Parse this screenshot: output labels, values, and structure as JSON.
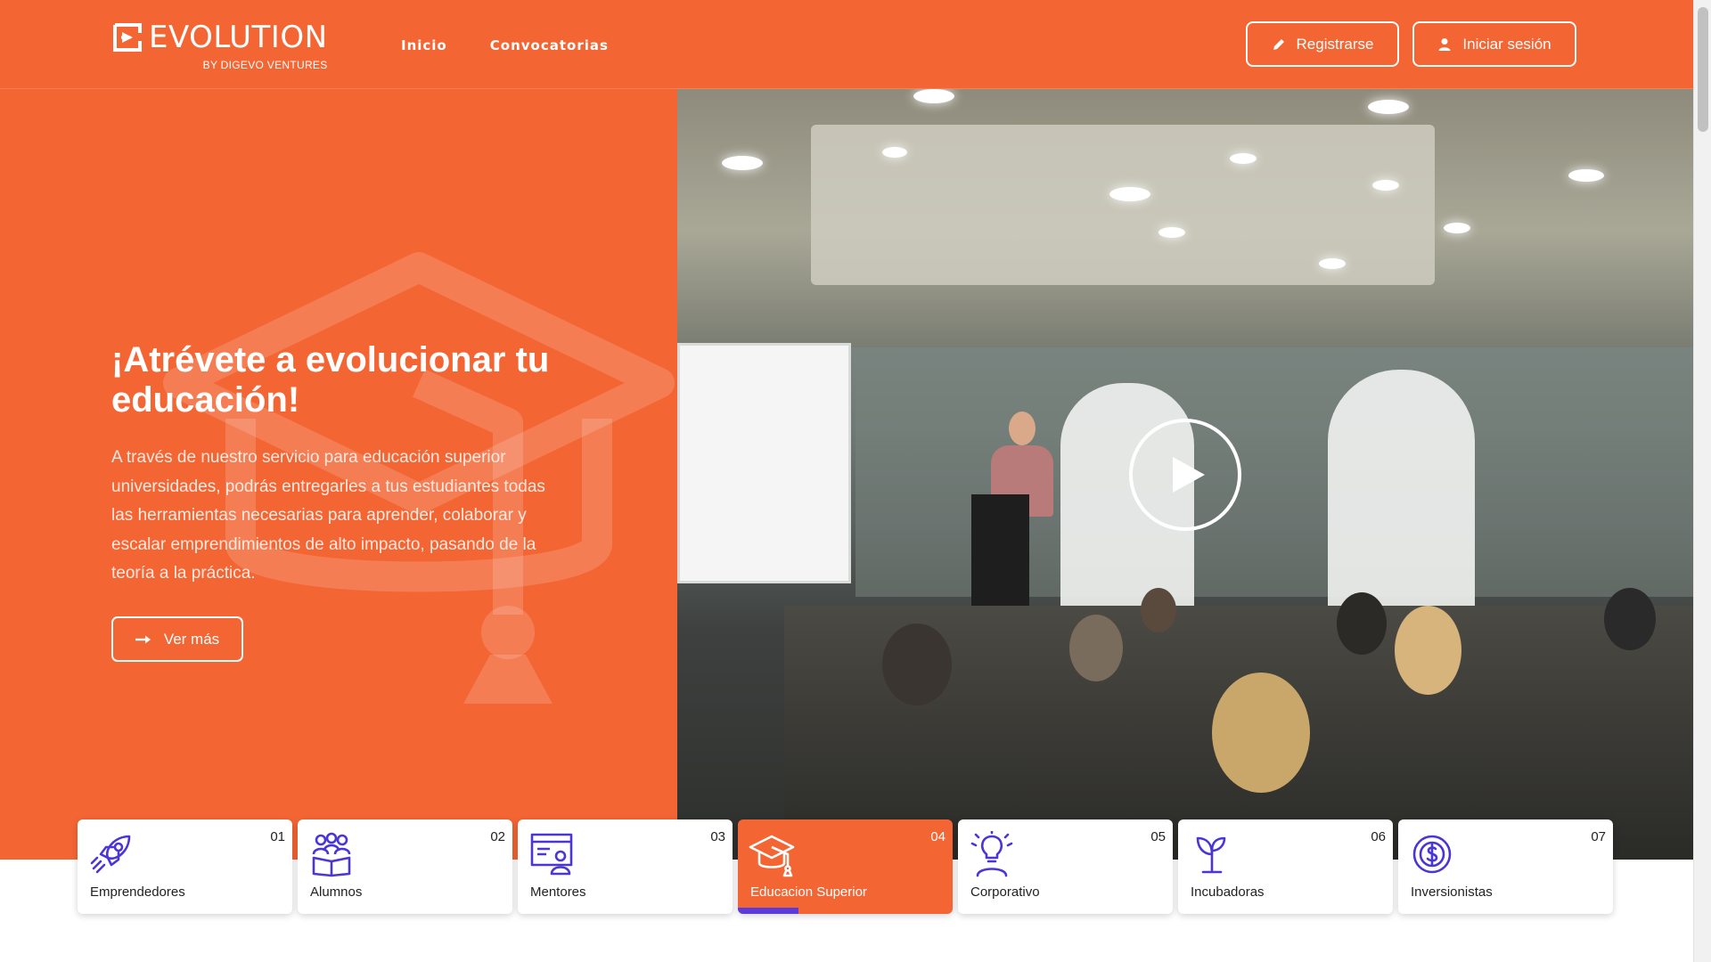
{
  "brand": {
    "name": "EVOLUTION",
    "sub": "BY DIGEVO VENTURES"
  },
  "nav": {
    "items": [
      "Inicio",
      "Convocatorias"
    ]
  },
  "header": {
    "register_label": "Registrarse",
    "login_label": "Iniciar sesión",
    "register_icon": "pencil-icon",
    "login_icon": "user-icon"
  },
  "hero": {
    "title": "¡Atrévete a evolucionar tu educación!",
    "description": "A través de nuestro servicio para educación superior universidades, podrás entregarles a tus estudiantes todas las herramientas necesarias para aprender, colaborar y escalar emprendimientos de alto impacto, pasando de la teoría a la práctica.",
    "cta_label": "Ver más",
    "cta_icon": "arrow-right-icon",
    "background_icon": "graduation-cap-icon",
    "video_icon": "play-icon"
  },
  "categories": [
    {
      "num": "01",
      "label": "Emprendedores",
      "icon": "rocket-icon",
      "active": false
    },
    {
      "num": "02",
      "label": "Alumnos",
      "icon": "students-icon",
      "active": false
    },
    {
      "num": "03",
      "label": "Mentores",
      "icon": "mentor-board-icon",
      "active": false
    },
    {
      "num": "04",
      "label": "Educacion Superior",
      "icon": "graduation-cap-icon",
      "active": true
    },
    {
      "num": "05",
      "label": "Corporativo",
      "icon": "idea-person-icon",
      "active": false
    },
    {
      "num": "06",
      "label": "Incubadoras",
      "icon": "sprout-icon",
      "active": false
    },
    {
      "num": "07",
      "label": "Inversionistas",
      "icon": "dollar-coin-icon",
      "active": false
    }
  ],
  "colors": {
    "brand_orange": "#f46534",
    "accent_purple": "#5b3bd9",
    "icon_blue": "#4a36d6",
    "white": "#ffffff"
  }
}
